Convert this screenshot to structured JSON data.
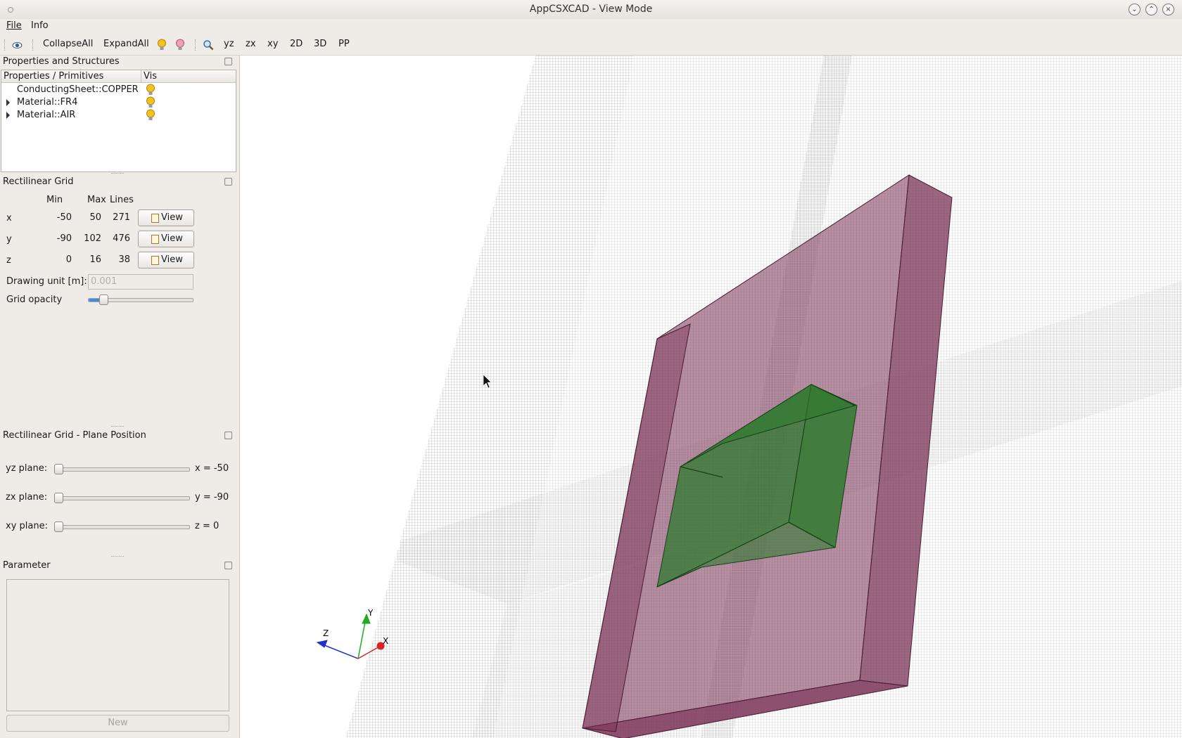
{
  "window": {
    "title": "AppCSXCAD - View Mode"
  },
  "menu": {
    "file": "File",
    "info": "Info"
  },
  "toolbar": {
    "collapse": "CollapseAll",
    "expand": "ExpandAll",
    "yz": "yz",
    "zx": "zx",
    "xy": "xy",
    "view2d": "2D",
    "view3d": "3D",
    "pp": "PP"
  },
  "props_panel": {
    "title": "Properties and Structures",
    "col_primitives": "Properties / Primitives",
    "col_vis": "Vis",
    "items": [
      {
        "label": "ConductingSheet::COPPER",
        "expandable": false
      },
      {
        "label": "Material::FR4",
        "expandable": true
      },
      {
        "label": "Material::AIR",
        "expandable": true
      }
    ]
  },
  "grid_panel": {
    "title": "Rectilinear Grid",
    "col_min": "Min",
    "col_max": "Max",
    "col_lines": "Lines",
    "rows": [
      {
        "axis": "x",
        "min": "-50",
        "max": "50",
        "lines": "271",
        "button": "View"
      },
      {
        "axis": "y",
        "min": "-90",
        "max": "102",
        "lines": "476",
        "button": "View"
      },
      {
        "axis": "z",
        "min": "0",
        "max": "16",
        "lines": "38",
        "button": "View"
      }
    ],
    "unit_label": "Drawing unit [m]:",
    "unit_value": "0.001",
    "opacity_label": "Grid opacity",
    "opacity_fraction": 0.15
  },
  "plane_panel": {
    "title": "Rectilinear Grid - Plane Position",
    "planes": [
      {
        "label": "yz plane:",
        "value": "x = -50"
      },
      {
        "label": "zx plane:",
        "value": "y = -90"
      },
      {
        "label": "xy plane:",
        "value": "z = 0"
      }
    ]
  },
  "param_panel": {
    "title": "Parameter",
    "new_button": "New"
  },
  "axes": {
    "x": "X",
    "y": "Y",
    "z": "Z"
  },
  "colors": {
    "substrate": "#7a3356",
    "patch": "#2f7a2f",
    "axis_x": "#dd2222",
    "axis_y": "#22aa22",
    "axis_z": "#2233cc"
  }
}
